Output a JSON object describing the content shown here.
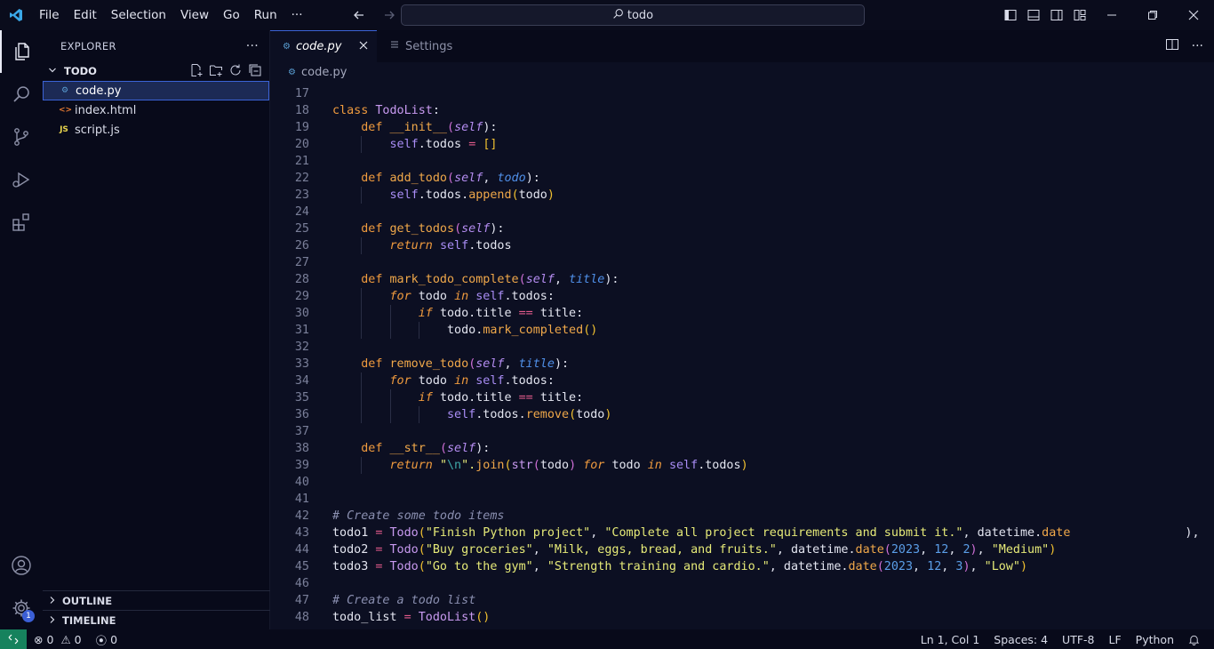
{
  "titlebar": {
    "menu": [
      "File",
      "Edit",
      "Selection",
      "View",
      "Go",
      "Run",
      "···"
    ],
    "search_text": "todo"
  },
  "sidebar": {
    "title": "EXPLORER",
    "folder": "TODO",
    "files": [
      {
        "name": "code.py",
        "icon": "python-file-icon",
        "selected": true
      },
      {
        "name": "index.html",
        "icon": "html-file-icon",
        "selected": false
      },
      {
        "name": "script.js",
        "icon": "js-file-icon",
        "selected": false
      }
    ],
    "outline": "OUTLINE",
    "timeline": "TIMELINE"
  },
  "tabs": [
    {
      "label": "code.py",
      "active": true
    },
    {
      "label": "Settings",
      "active": false
    }
  ],
  "breadcrumb": "code.py",
  "activity": {
    "settings_badge": "1"
  },
  "status": {
    "errors": "0",
    "warnings": "0",
    "ports": "0",
    "position": "Ln 1, Col 1",
    "spaces": "Spaces: 4",
    "encoding": "UTF-8",
    "eol": "LF",
    "language": "Python"
  },
  "colors": {
    "accent": "#3b63d6",
    "remote": "#16825d",
    "background": "#0c0f22"
  },
  "code_lines": [
    {
      "n": "17",
      "g": 0,
      "t": [
        [
          "",
          "txt"
        ]
      ]
    },
    {
      "n": "18",
      "g": 0,
      "t": [
        [
          "class ",
          "kw"
        ],
        [
          "TodoList",
          "cls"
        ],
        [
          ":",
          "txt"
        ]
      ]
    },
    {
      "n": "19",
      "g": 1,
      "t": [
        [
          "    def ",
          "kw"
        ],
        [
          "__init__",
          "fn"
        ],
        [
          "(",
          "br2"
        ],
        [
          "self",
          "slf"
        ],
        [
          "):",
          "txt"
        ]
      ]
    },
    {
      "n": "20",
      "g": 2,
      "t": [
        [
          "        ",
          "txt"
        ],
        [
          "self",
          "sv"
        ],
        [
          ".todos ",
          "txt"
        ],
        [
          "= ",
          "op"
        ],
        [
          "[]",
          "br"
        ]
      ]
    },
    {
      "n": "21",
      "g": 1,
      "t": [
        [
          "",
          "txt"
        ]
      ]
    },
    {
      "n": "22",
      "g": 1,
      "t": [
        [
          "    def ",
          "kw"
        ],
        [
          "add_todo",
          "fn"
        ],
        [
          "(",
          "br2"
        ],
        [
          "self",
          "slf"
        ],
        [
          ", ",
          "txt"
        ],
        [
          "todo",
          "prm"
        ],
        [
          "):",
          "txt"
        ]
      ]
    },
    {
      "n": "23",
      "g": 2,
      "t": [
        [
          "        ",
          "txt"
        ],
        [
          "self",
          "sv"
        ],
        [
          ".todos.",
          "txt"
        ],
        [
          "append",
          "fn"
        ],
        [
          "(",
          "br"
        ],
        [
          "todo",
          "txt"
        ],
        [
          ")",
          "br"
        ]
      ]
    },
    {
      "n": "24",
      "g": 1,
      "t": [
        [
          "",
          "txt"
        ]
      ]
    },
    {
      "n": "25",
      "g": 1,
      "t": [
        [
          "    def ",
          "kw"
        ],
        [
          "get_todos",
          "fn"
        ],
        [
          "(",
          "br2"
        ],
        [
          "self",
          "slf"
        ],
        [
          "):",
          "txt"
        ]
      ]
    },
    {
      "n": "26",
      "g": 2,
      "t": [
        [
          "        ",
          "txt"
        ],
        [
          "return ",
          "kwi"
        ],
        [
          "self",
          "sv"
        ],
        [
          ".todos",
          "txt"
        ]
      ]
    },
    {
      "n": "27",
      "g": 1,
      "t": [
        [
          "",
          "txt"
        ]
      ]
    },
    {
      "n": "28",
      "g": 1,
      "t": [
        [
          "    def ",
          "kw"
        ],
        [
          "mark_todo_complete",
          "fn"
        ],
        [
          "(",
          "br2"
        ],
        [
          "self",
          "slf"
        ],
        [
          ", ",
          "txt"
        ],
        [
          "title",
          "prm"
        ],
        [
          "):",
          "txt"
        ]
      ]
    },
    {
      "n": "29",
      "g": 2,
      "t": [
        [
          "        ",
          "txt"
        ],
        [
          "for ",
          "kwi"
        ],
        [
          "todo ",
          "txt"
        ],
        [
          "in ",
          "kwi"
        ],
        [
          "self",
          "sv"
        ],
        [
          ".todos:",
          "txt"
        ]
      ]
    },
    {
      "n": "30",
      "g": 3,
      "t": [
        [
          "            ",
          "txt"
        ],
        [
          "if ",
          "kwi"
        ],
        [
          "todo.title ",
          "txt"
        ],
        [
          "== ",
          "op"
        ],
        [
          "title:",
          "txt"
        ]
      ]
    },
    {
      "n": "31",
      "g": 4,
      "t": [
        [
          "                todo.",
          "txt"
        ],
        [
          "mark_completed",
          "fn"
        ],
        [
          "()",
          "br"
        ]
      ]
    },
    {
      "n": "32",
      "g": 1,
      "t": [
        [
          "",
          "txt"
        ]
      ]
    },
    {
      "n": "33",
      "g": 1,
      "t": [
        [
          "    def ",
          "kw"
        ],
        [
          "remove_todo",
          "fn"
        ],
        [
          "(",
          "br2"
        ],
        [
          "self",
          "slf"
        ],
        [
          ", ",
          "txt"
        ],
        [
          "title",
          "prm"
        ],
        [
          "):",
          "txt"
        ]
      ]
    },
    {
      "n": "34",
      "g": 2,
      "t": [
        [
          "        ",
          "txt"
        ],
        [
          "for ",
          "kwi"
        ],
        [
          "todo ",
          "txt"
        ],
        [
          "in ",
          "kwi"
        ],
        [
          "self",
          "sv"
        ],
        [
          ".todos:",
          "txt"
        ]
      ]
    },
    {
      "n": "35",
      "g": 3,
      "t": [
        [
          "            ",
          "txt"
        ],
        [
          "if ",
          "kwi"
        ],
        [
          "todo.title ",
          "txt"
        ],
        [
          "== ",
          "op"
        ],
        [
          "title:",
          "txt"
        ]
      ]
    },
    {
      "n": "36",
      "g": 4,
      "t": [
        [
          "                ",
          "txt"
        ],
        [
          "self",
          "sv"
        ],
        [
          ".todos.",
          "txt"
        ],
        [
          "remove",
          "fn"
        ],
        [
          "(",
          "br"
        ],
        [
          "todo",
          "txt"
        ],
        [
          ")",
          "br"
        ]
      ]
    },
    {
      "n": "37",
      "g": 1,
      "t": [
        [
          "",
          "txt"
        ]
      ]
    },
    {
      "n": "38",
      "g": 1,
      "t": [
        [
          "    def ",
          "kw"
        ],
        [
          "__str__",
          "fn"
        ],
        [
          "(",
          "br2"
        ],
        [
          "self",
          "slf"
        ],
        [
          "):",
          "txt"
        ]
      ]
    },
    {
      "n": "39",
      "g": 2,
      "t": [
        [
          "        ",
          "txt"
        ],
        [
          "return ",
          "kwi"
        ],
        [
          "\"",
          "str"
        ],
        [
          "\\n",
          "esc"
        ],
        [
          "\".",
          "str"
        ],
        [
          "join",
          "fn"
        ],
        [
          "(",
          "br"
        ],
        [
          "str",
          "cls"
        ],
        [
          "(",
          "br2"
        ],
        [
          "todo",
          "txt"
        ],
        [
          ") ",
          "br2"
        ],
        [
          "for ",
          "kwi"
        ],
        [
          "todo ",
          "txt"
        ],
        [
          "in ",
          "kwi"
        ],
        [
          "self",
          "sv"
        ],
        [
          ".todos",
          "txt"
        ],
        [
          ")",
          "br"
        ]
      ]
    },
    {
      "n": "40",
      "g": 0,
      "t": [
        [
          "",
          "txt"
        ]
      ]
    },
    {
      "n": "41",
      "g": 0,
      "t": [
        [
          "",
          "txt"
        ]
      ]
    },
    {
      "n": "42",
      "g": 0,
      "t": [
        [
          "# Create some todo items",
          "cmt"
        ]
      ]
    },
    {
      "n": "43",
      "g": 0,
      "t": [
        [
          "todo1 ",
          "txt"
        ],
        [
          "= ",
          "op"
        ],
        [
          "Todo",
          "cls"
        ],
        [
          "(",
          "br"
        ],
        [
          "\"Finish Python project\"",
          "str"
        ],
        [
          ", ",
          "txt"
        ],
        [
          "\"Complete all project requirements and submit it.\"",
          "str"
        ],
        [
          ", datetime.",
          "txt"
        ],
        [
          "date",
          "fn"
        ],
        [
          "                ),",
          "txt"
        ]
      ]
    },
    {
      "n": "44",
      "g": 0,
      "t": [
        [
          "todo2 ",
          "txt"
        ],
        [
          "= ",
          "op"
        ],
        [
          "Todo",
          "cls"
        ],
        [
          "(",
          "br"
        ],
        [
          "\"Buy groceries\"",
          "str"
        ],
        [
          ", ",
          "txt"
        ],
        [
          "\"Milk, eggs, bread, and fruits.\"",
          "str"
        ],
        [
          ", datetime.",
          "txt"
        ],
        [
          "date",
          "fn"
        ],
        [
          "(",
          "br2"
        ],
        [
          "2023",
          "num"
        ],
        [
          ", ",
          "txt"
        ],
        [
          "12",
          "num"
        ],
        [
          ", ",
          "txt"
        ],
        [
          "2",
          "num"
        ],
        [
          ")",
          "br2"
        ],
        [
          ", ",
          "txt"
        ],
        [
          "\"Medium\"",
          "str"
        ],
        [
          ")",
          "br"
        ]
      ]
    },
    {
      "n": "45",
      "g": 0,
      "t": [
        [
          "todo3 ",
          "txt"
        ],
        [
          "= ",
          "op"
        ],
        [
          "Todo",
          "cls"
        ],
        [
          "(",
          "br"
        ],
        [
          "\"Go to the gym\"",
          "str"
        ],
        [
          ", ",
          "txt"
        ],
        [
          "\"Strength training and cardio.\"",
          "str"
        ],
        [
          ", datetime.",
          "txt"
        ],
        [
          "date",
          "fn"
        ],
        [
          "(",
          "br2"
        ],
        [
          "2023",
          "num"
        ],
        [
          ", ",
          "txt"
        ],
        [
          "12",
          "num"
        ],
        [
          ", ",
          "txt"
        ],
        [
          "3",
          "num"
        ],
        [
          ")",
          "br2"
        ],
        [
          ", ",
          "txt"
        ],
        [
          "\"Low\"",
          "str"
        ],
        [
          ")",
          "br"
        ]
      ]
    },
    {
      "n": "46",
      "g": 0,
      "t": [
        [
          "",
          "txt"
        ]
      ]
    },
    {
      "n": "47",
      "g": 0,
      "t": [
        [
          "# Create a todo list",
          "cmt"
        ]
      ]
    },
    {
      "n": "48",
      "g": 0,
      "t": [
        [
          "todo_list ",
          "txt"
        ],
        [
          "= ",
          "op"
        ],
        [
          "TodoList",
          "cls"
        ],
        [
          "()",
          "br"
        ]
      ]
    }
  ]
}
